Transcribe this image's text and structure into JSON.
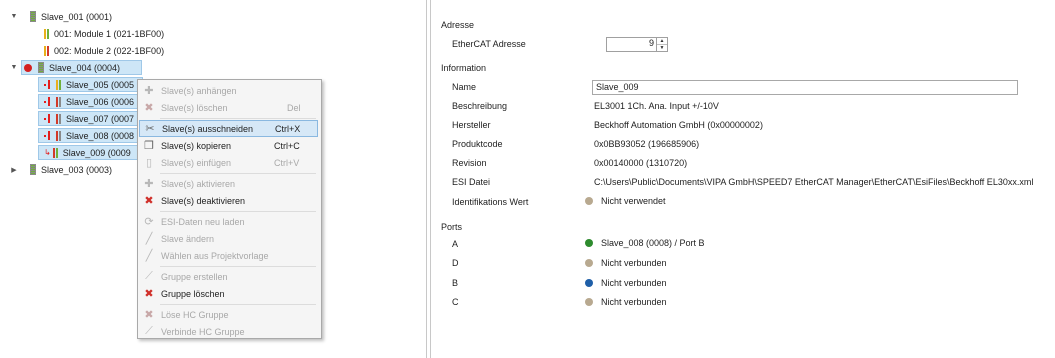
{
  "tree": {
    "slave_001": "Slave_001 (0001)",
    "module_1": "001: Module 1 (021-1BF00)",
    "module_2": "002: Module 2 (022-1BF00)",
    "slave_004": "Slave_004 (0004)",
    "slave_005": "Slave_005 (0005",
    "slave_006": "Slave_006 (0006",
    "slave_007": "Slave_007 (0007",
    "slave_008": "Slave_008 (0008",
    "slave_009": "Slave_009 (0009",
    "slave_003": "Slave_003 (0003)"
  },
  "menu": {
    "anhaengen": "Slave(s) anhängen",
    "loeschen": "Slave(s) löschen",
    "loeschen_sc": "Del",
    "ausschneiden": "Slave(s) ausschneiden",
    "ausschneiden_sc": "Ctrl+X",
    "kopieren": "Slave(s) kopieren",
    "kopieren_sc": "Ctrl+C",
    "einfuegen": "Slave(s) einfügen",
    "einfuegen_sc": "Ctrl+V",
    "aktivieren": "Slave(s) aktivieren",
    "deaktivieren": "Slave(s) deaktivieren",
    "esi_laden": "ESI-Daten neu laden",
    "aendern": "Slave ändern",
    "projektvorlage": "Wählen aus Projektvorlage",
    "gruppe_erstellen": "Gruppe erstellen",
    "gruppe_loeschen": "Gruppe löschen",
    "loese_hc": "Löse HC Gruppe",
    "verbinde_hc": "Verbinde HC Gruppe"
  },
  "props": {
    "adresse_section": "Adresse",
    "ethercat_label": "EtherCAT Adresse",
    "ethercat_value": "9",
    "information_section": "Information",
    "name_label": "Name",
    "name_value": "Slave_009",
    "beschreibung_label": "Beschreibung",
    "beschreibung_value": "EL3001 1Ch. Ana. Input +/-10V",
    "hersteller_label": "Hersteller",
    "hersteller_value": "Beckhoff Automation GmbH (0x00000002)",
    "produktcode_label": "Produktcode",
    "produktcode_value": "0x0BB93052 (196685906)",
    "revision_label": "Revision",
    "revision_value": "0x00140000 (1310720)",
    "esi_label": "ESI Datei",
    "esi_value": "C:\\Users\\Public\\Documents\\VIPA GmbH\\SPEED7 EtherCAT Manager\\EtherCAT\\EsiFiles\\Beckhoff EL30xx.xml",
    "ident_label": "Identifikations Wert",
    "ident_value": "Nicht verwendet",
    "ports_section": "Ports",
    "port_a_label": "A",
    "port_a_value": "Slave_008 (0008) / Port B",
    "port_d_label": "D",
    "port_d_value": "Nicht verbunden",
    "port_b_label": "B",
    "port_b_value": "Nicht verbunden",
    "port_c_label": "C",
    "port_c_value": "Nicht verbunden"
  },
  "colors": {
    "selection": "#cde6f7",
    "menu_highlight": "#d6e8f7",
    "port_green": "#2e8b2e",
    "port_blue": "#1f5fa8",
    "port_grey": "#b8a990"
  }
}
